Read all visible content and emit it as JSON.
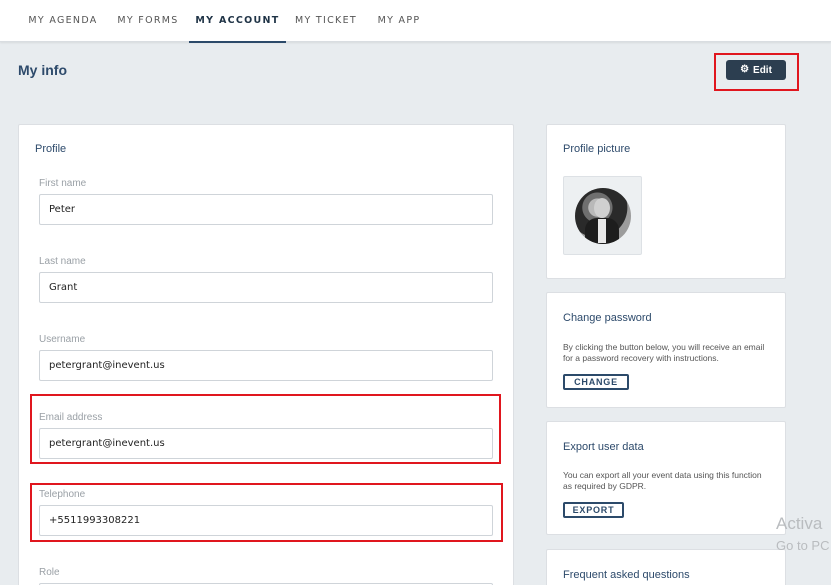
{
  "nav": {
    "tabs": [
      {
        "label": "MY AGENDA"
      },
      {
        "label": "MY FORMS"
      },
      {
        "label": "MY ACCOUNT"
      },
      {
        "label": "MY TICKET"
      },
      {
        "label": "MY APP"
      }
    ],
    "active": "MY ACCOUNT"
  },
  "page": {
    "title": "My info",
    "edit_label": "Edit",
    "edit_icon": "gear-icon"
  },
  "profile": {
    "title": "Profile",
    "fields": [
      {
        "label": "First name",
        "value": "Peter"
      },
      {
        "label": "Last name",
        "value": "Grant"
      },
      {
        "label": "Username",
        "value": "petergrant@inevent.us"
      },
      {
        "label": "Email address",
        "value": "petergrant@inevent.us"
      },
      {
        "label": "Telephone",
        "value": "+5511993308221"
      },
      {
        "label": "Role",
        "value": ""
      }
    ]
  },
  "picture": {
    "title": "Profile picture"
  },
  "password": {
    "title": "Change password",
    "description": "By clicking the button below, you will receive an email for a password recovery with instructions.",
    "button": "CHANGE"
  },
  "export": {
    "title": "Export user data",
    "description": "You can export all your event data using this function as required by GDPR.",
    "button": "EXPORT"
  },
  "faq": {
    "title": "Frequent asked questions"
  },
  "watermark": {
    "line1": "Activa",
    "line2": "Go to PC"
  },
  "colors": {
    "accent": "#2c4a6a",
    "highlight": "#e0161e",
    "background": "#e8ecef"
  }
}
